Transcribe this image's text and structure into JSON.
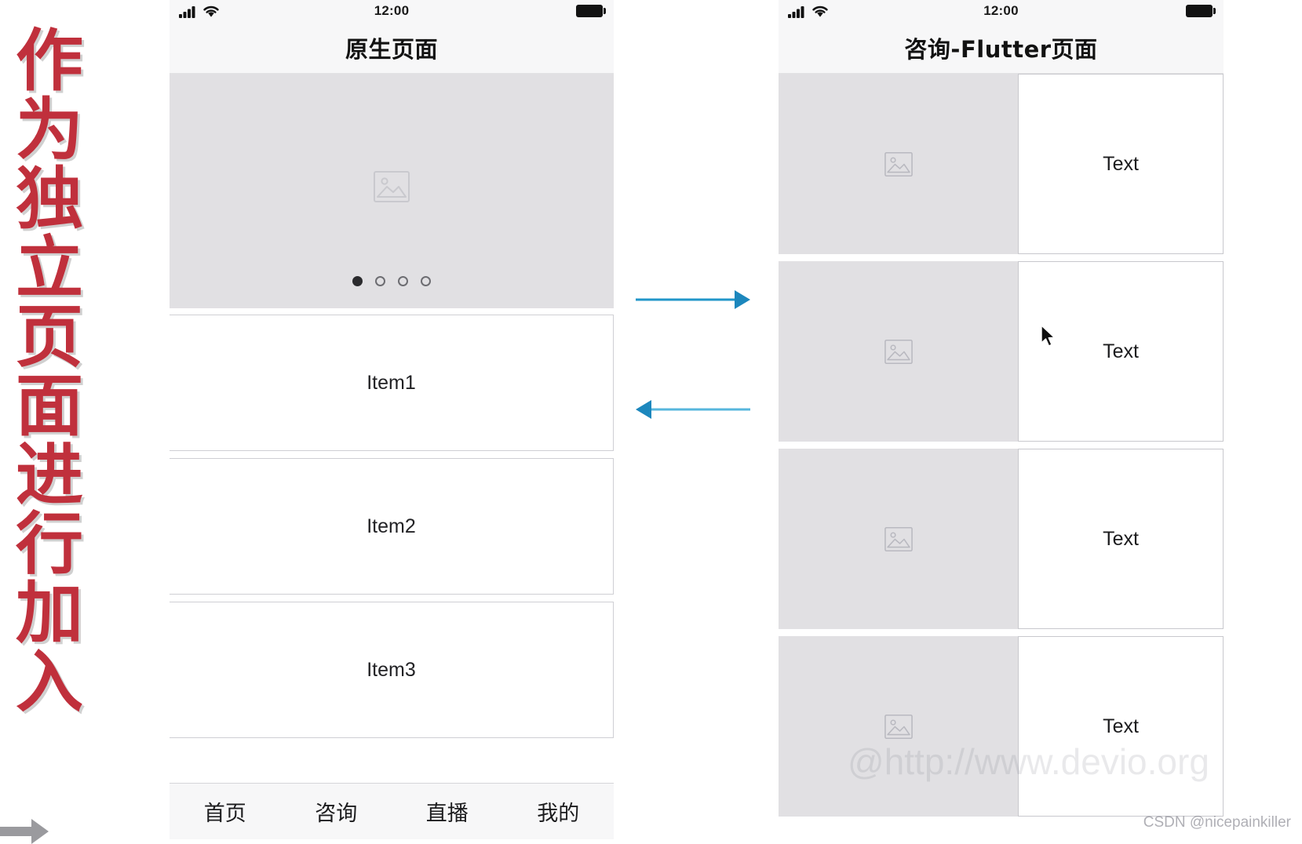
{
  "annotation": {
    "vertical_caption": "作为独立页面进行加入",
    "caption_color": "#c0303c",
    "arrow_color": "#2196c9",
    "arrows": [
      {
        "name": "native-to-flutter",
        "direction": "right"
      },
      {
        "name": "flutter-to-native",
        "direction": "left"
      }
    ]
  },
  "phone_native": {
    "statusbar": {
      "time": "12:00",
      "signal_icon": "cellular-signal-icon",
      "wifi_icon": "wifi-icon",
      "battery_icon": "battery-full-icon"
    },
    "navbar": {
      "title": "原生页面"
    },
    "banner": {
      "placeholder_icon": "image-placeholder-icon",
      "dots": 4,
      "active_dot": 1
    },
    "list": [
      {
        "label": "Item1"
      },
      {
        "label": "Item2"
      },
      {
        "label": "Item3"
      }
    ],
    "tabbar": [
      {
        "label": "首页"
      },
      {
        "label": "咨询"
      },
      {
        "label": "直播"
      },
      {
        "label": "我的"
      }
    ]
  },
  "phone_flutter": {
    "statusbar": {
      "time": "12:00",
      "signal_icon": "cellular-signal-icon",
      "wifi_icon": "wifi-icon",
      "battery_icon": "battery-full-icon"
    },
    "navbar": {
      "title": "咨询-Flutter页面"
    },
    "list": [
      {
        "image_icon": "image-placeholder-icon",
        "label": "Text"
      },
      {
        "image_icon": "image-placeholder-icon",
        "label": "Text"
      },
      {
        "image_icon": "image-placeholder-icon",
        "label": "Text"
      },
      {
        "image_icon": "image-placeholder-icon",
        "label": "Text"
      }
    ]
  },
  "watermarks": {
    "url": "@http://www.devio.org",
    "credit": "CSDN @nicepainkiller"
  }
}
